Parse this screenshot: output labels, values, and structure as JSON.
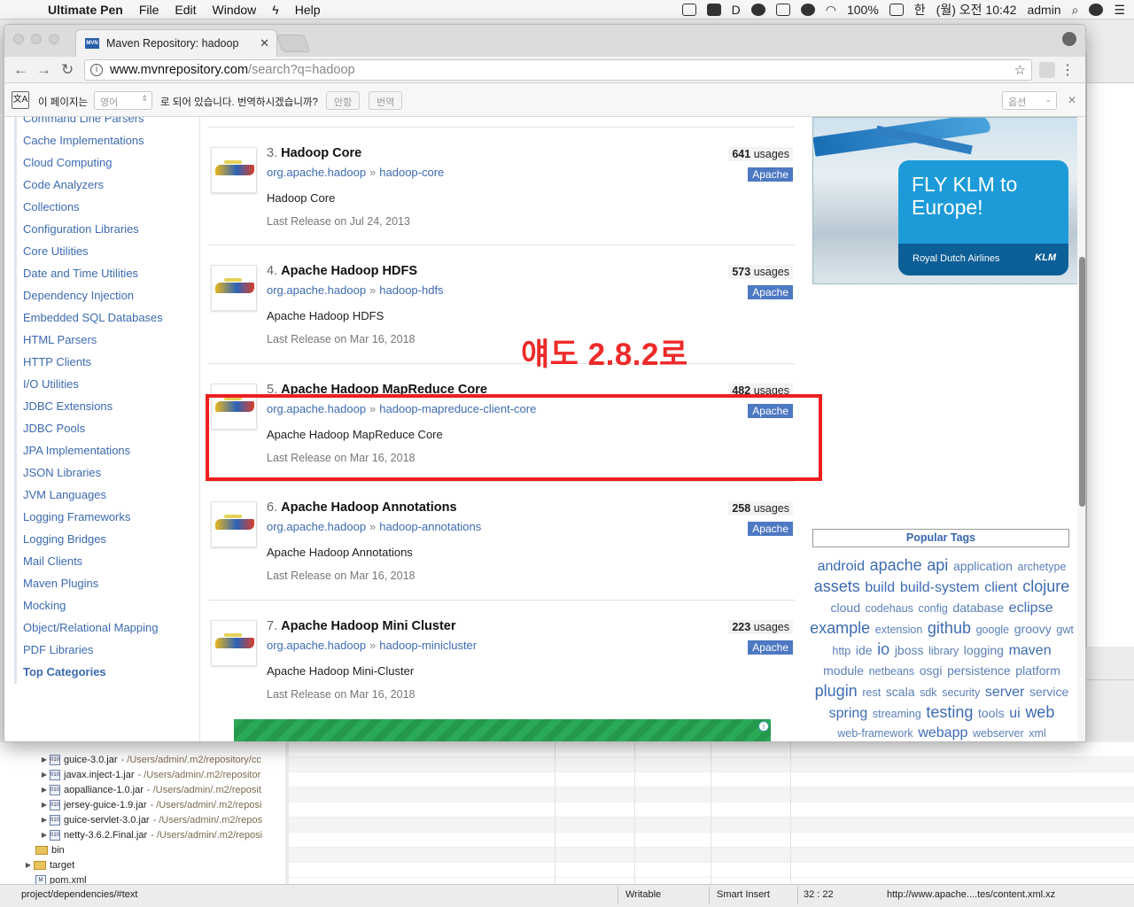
{
  "menubar": {
    "app_name": "Ultimate Pen",
    "items": [
      "File",
      "Edit",
      "Window",
      "Help"
    ],
    "battery": "100%",
    "input_lang": "한",
    "clock": "(월) 오전 10:42",
    "user": "admin"
  },
  "browser": {
    "tab_title": "Maven Repository: hadoop",
    "favicon_text": "MVN",
    "url_host": "www.mvnrepository.com",
    "url_path": "/search?q=hadoop"
  },
  "translate_bar": {
    "icon_text": "文A",
    "prefix": "이 페이지는",
    "language": "영어",
    "question": "로 되어 있습니다. 번역하시겠습니까?",
    "no_button": "안함",
    "translate_button": "번역",
    "options": "옵션"
  },
  "sidebar": {
    "items": [
      "Command Line Parsers",
      "Cache Implementations",
      "Cloud Computing",
      "Code Analyzers",
      "Collections",
      "Configuration Libraries",
      "Core Utilities",
      "Date and Time Utilities",
      "Dependency Injection",
      "Embedded SQL Databases",
      "HTML Parsers",
      "HTTP Clients",
      "I/O Utilities",
      "JDBC Extensions",
      "JDBC Pools",
      "JPA Implementations",
      "JSON Libraries",
      "JVM Languages",
      "Logging Frameworks",
      "Logging Bridges",
      "Mail Clients",
      "Maven Plugins",
      "Mocking",
      "Object/Relational Mapping",
      "PDF Libraries"
    ],
    "top_categories": "Top Categories"
  },
  "results": [
    {
      "num": "3.",
      "name": "Hadoop Core",
      "group": "org.apache.hadoop",
      "artifact": "hadoop-core",
      "description": "Hadoop Core",
      "release": "Last Release on Jul 24, 2013",
      "usages": "641",
      "usages_label": "usages",
      "license": "Apache"
    },
    {
      "num": "4.",
      "name": "Apache Hadoop HDFS",
      "group": "org.apache.hadoop",
      "artifact": "hadoop-hdfs",
      "description": "Apache Hadoop HDFS",
      "release": "Last Release on Mar 16, 2018",
      "usages": "573",
      "usages_label": "usages",
      "license": "Apache"
    },
    {
      "num": "5.",
      "name": "Apache Hadoop MapReduce Core",
      "group": "org.apache.hadoop",
      "artifact": "hadoop-mapreduce-client-core",
      "description": "Apache Hadoop MapReduce Core",
      "release": "Last Release on Mar 16, 2018",
      "usages": "482",
      "usages_label": "usages",
      "license": "Apache"
    },
    {
      "num": "6.",
      "name": "Apache Hadoop Annotations",
      "group": "org.apache.hadoop",
      "artifact": "hadoop-annotations",
      "description": "Apache Hadoop Annotations",
      "release": "Last Release on Mar 16, 2018",
      "usages": "258",
      "usages_label": "usages",
      "license": "Apache"
    },
    {
      "num": "7.",
      "name": "Apache Hadoop Mini Cluster",
      "group": "org.apache.hadoop",
      "artifact": "hadoop-minicluster",
      "description": "Apache Hadoop Mini-Cluster",
      "release": "Last Release on Mar 16, 2018",
      "usages": "223",
      "usages_label": "usages",
      "license": "Apache"
    }
  ],
  "coords_separator": "»",
  "annotation": "얘도 2.8.2로",
  "klm_ad": {
    "headline": "FLY KLM to Europe!",
    "airline": "Royal Dutch Airlines",
    "logo": "KLM"
  },
  "popular_tags": {
    "title": "Popular Tags",
    "tags": [
      [
        "android",
        3
      ],
      [
        "apache",
        4
      ],
      [
        "api",
        4
      ],
      [
        "application",
        2
      ],
      [
        "archetype",
        1
      ],
      [
        "assets",
        4
      ],
      [
        "build",
        3
      ],
      [
        "build-system",
        3
      ],
      [
        "client",
        3
      ],
      [
        "clojure",
        4
      ],
      [
        "cloud",
        2
      ],
      [
        "codehaus",
        1
      ],
      [
        "config",
        1
      ],
      [
        "database",
        2
      ],
      [
        "eclipse",
        3
      ],
      [
        "example",
        4
      ],
      [
        "extension",
        1
      ],
      [
        "github",
        4
      ],
      [
        "google",
        1
      ],
      [
        "groovy",
        2
      ],
      [
        "gwt",
        1
      ],
      [
        "http",
        1
      ],
      [
        "ide",
        2
      ],
      [
        "io",
        4
      ],
      [
        "jboss",
        2
      ],
      [
        "library",
        1
      ],
      [
        "logging",
        2
      ],
      [
        "maven",
        3
      ],
      [
        "module",
        2
      ],
      [
        "netbeans",
        1
      ],
      [
        "osgi",
        2
      ],
      [
        "persistence",
        2
      ],
      [
        "platform",
        2
      ],
      [
        "plugin",
        4
      ],
      [
        "rest",
        1
      ],
      [
        "scala",
        2
      ],
      [
        "sdk",
        1
      ],
      [
        "security",
        1
      ],
      [
        "server",
        3
      ],
      [
        "service",
        2
      ],
      [
        "spring",
        3
      ],
      [
        "streaming",
        1
      ],
      [
        "testing",
        4
      ],
      [
        "tools",
        2
      ],
      [
        "ui",
        3
      ],
      [
        "web",
        4
      ],
      [
        "web-framework",
        1
      ],
      [
        "webapp",
        3
      ],
      [
        "webserver",
        1
      ],
      [
        "xml",
        1
      ]
    ]
  },
  "ide": {
    "tree": [
      {
        "name": "guice-3.0.jar",
        "path": "- /Users/admin/.m2/repository/cc"
      },
      {
        "name": "javax.inject-1.jar",
        "path": "- /Users/admin/.m2/repositor"
      },
      {
        "name": "aopalliance-1.0.jar",
        "path": "- /Users/admin/.m2/reposit"
      },
      {
        "name": "jersey-guice-1.9.jar",
        "path": "- /Users/admin/.m2/reposi"
      },
      {
        "name": "guice-servlet-3.0.jar",
        "path": "- /Users/admin/.m2/repos"
      },
      {
        "name": "netty-3.6.2.Final.jar",
        "path": "- /Users/admin/.m2/reposi"
      }
    ],
    "folders": [
      "bin",
      "target"
    ],
    "file": "pom.xml",
    "status": {
      "path": "project/dependencies/#text",
      "writable": "Writable",
      "insert": "Smart Insert",
      "position": "32 : 22",
      "url": "http://www.apache....tes/content.xml.xz"
    }
  }
}
